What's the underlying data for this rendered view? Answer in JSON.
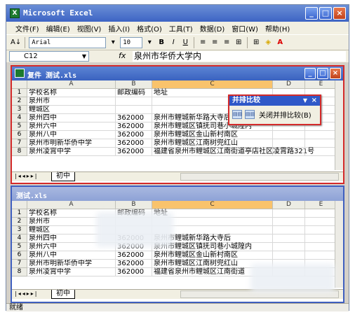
{
  "app": {
    "title": "Microsoft Excel",
    "icon_letter": "X",
    "window_buttons": [
      "minimize",
      "maximize",
      "close"
    ]
  },
  "menu": [
    "文件(F)",
    "编辑(E)",
    "视图(V)",
    "插入(I)",
    "格式(O)",
    "工具(T)",
    "数据(D)",
    "窗口(W)",
    "帮助(H)"
  ],
  "toolbar": {
    "font_name": "Arial",
    "font_size": "10",
    "bold": "B",
    "italic": "I",
    "underline": "U",
    "sort_label": "A↓",
    "font_color_label": "A"
  },
  "formula_bar": {
    "cell_ref": "C12",
    "fx": "fx",
    "value": "泉州市华侨大学内"
  },
  "workbook1": {
    "title": "复件 测试.xls",
    "sheet_tab": "初中"
  },
  "workbook2": {
    "title": "测试.xls",
    "sheet_tab": "初中"
  },
  "columns": [
    "A",
    "B",
    "C",
    "D",
    "E"
  ],
  "rows1": [
    {
      "n": "1",
      "a": "学校名称",
      "b": "邮政编码",
      "c": "地址"
    },
    {
      "n": "2",
      "a": "泉州市",
      "b": "",
      "c": ""
    },
    {
      "n": "3",
      "a": "鲤城区",
      "b": "",
      "c": ""
    },
    {
      "n": "4",
      "a": "泉州四中",
      "b": "362000",
      "c": "泉州市鲤城新华路大寺后"
    },
    {
      "n": "5",
      "a": "泉州六中",
      "b": "362000",
      "c": "泉州市鲤城区镇抚司巷小城隍内"
    },
    {
      "n": "6",
      "a": "泉州八中",
      "b": "362000",
      "c": "泉州市鲤城区金山新村南区"
    },
    {
      "n": "7",
      "a": "泉州市明新华侨中学",
      "b": "362000",
      "c": "泉州市鲤城区江南树兜红山"
    },
    {
      "n": "8",
      "a": "泉州凌霄中学",
      "b": "362000",
      "c": "福建省泉州市鲤城区江南街道亭店社区凌霄路321号"
    }
  ],
  "rows2": [
    {
      "n": "1",
      "a": "学校名称",
      "b": "邮政编码",
      "c": "地址"
    },
    {
      "n": "2",
      "a": "泉州市",
      "b": "",
      "c": ""
    },
    {
      "n": "3",
      "a": "鲤城区",
      "b": "",
      "c": ""
    },
    {
      "n": "4",
      "a": "泉州四中",
      "b": "362000",
      "c": "泉州市鲤城新华路大寺后"
    },
    {
      "n": "5",
      "a": "泉州六中",
      "b": "362000",
      "c": "泉州市鲤城区镇抚司巷小城隍内"
    },
    {
      "n": "6",
      "a": "泉州八中",
      "b": "362000",
      "c": "泉州市鲤城区金山新村南区"
    },
    {
      "n": "7",
      "a": "泉州市明新华侨中学",
      "b": "362000",
      "c": "泉州市鲤城区江南树兜红山"
    },
    {
      "n": "8",
      "a": "泉州凌霄中学",
      "b": "362000",
      "c": "福建省泉州市鲤城区江南街道"
    }
  ],
  "compare_toolbar": {
    "title": "并排比较",
    "close_label": "关闭并排比较(B)",
    "x": "×"
  },
  "status": "就绪"
}
